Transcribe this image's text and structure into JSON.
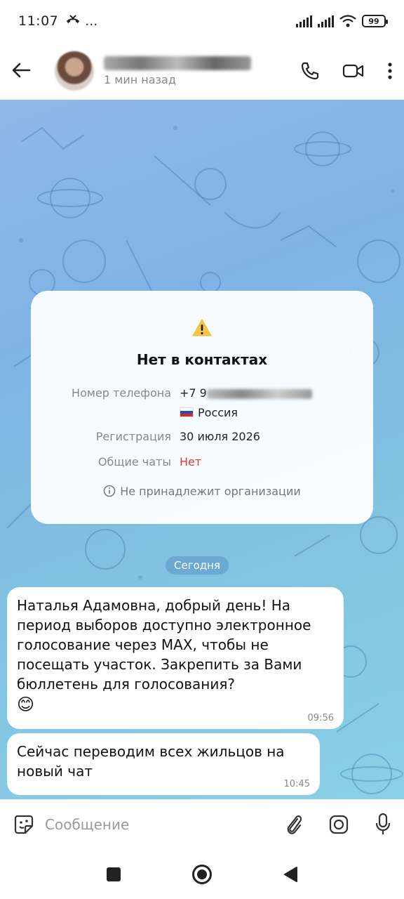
{
  "status_bar": {
    "time": "11:07",
    "notifications": "…",
    "battery": "99"
  },
  "header": {
    "last_seen": "1 мин назад"
  },
  "info_card": {
    "title": "Нет в контактах",
    "phone_label": "Номер телефона",
    "phone_value": "+7 9",
    "country": "Россия",
    "registration_label": "Регистрация",
    "registration_value": "30 июля 2026",
    "common_chats_label": "Общие чаты",
    "common_chats_value": "Нет",
    "org_note": "Не принадлежит организации"
  },
  "date_chip": "Сегодня",
  "messages": [
    {
      "text": "Наталья Адамовна, добрый день! На период выборов доступно электронное голосование через MAX, чтобы не посещать участок. Закрепить за Вами бюллетень для голосования?",
      "emoji": "😊",
      "time": "09:56"
    },
    {
      "text": "Сейчас переводим всех жильцов на новый чат",
      "time": "10:45"
    }
  ],
  "input": {
    "placeholder": "Сообщение"
  },
  "colors": {
    "accent_red": "#e03a3a",
    "chat_bg": "#80bfe4"
  }
}
